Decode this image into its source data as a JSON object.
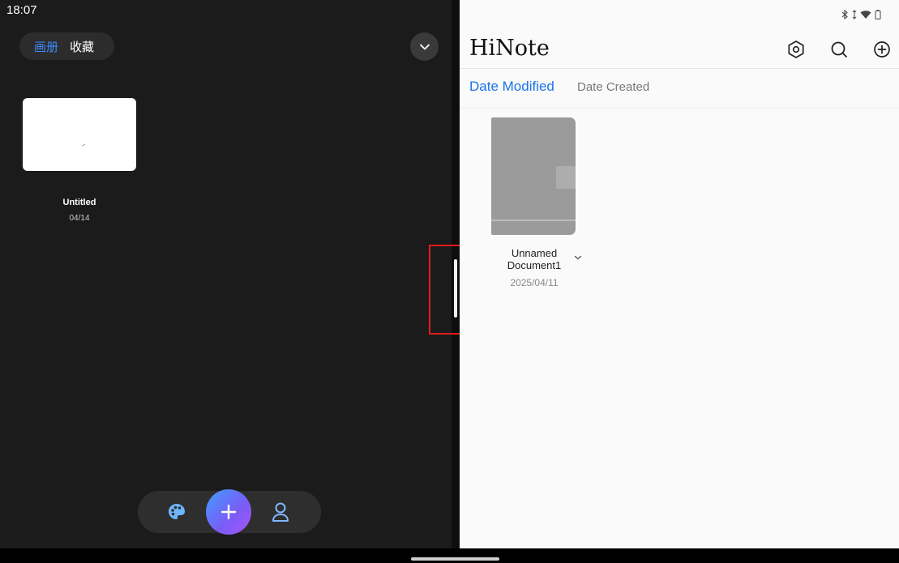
{
  "status_bar": {
    "time": "18:07"
  },
  "drawing_app": {
    "tabs": {
      "album": "画册",
      "favorites": "收藏"
    },
    "artwork": {
      "title": "Untitled",
      "date": "04/14"
    },
    "icons": {
      "expand": "chevron-down-icon",
      "palette": "palette-icon",
      "add": "plus-icon",
      "profile": "user-icon"
    }
  },
  "notes_app": {
    "title": "HiNote",
    "sort": {
      "modified": "Date Modified",
      "created": "Date Created"
    },
    "document": {
      "name": "Unnamed Document1",
      "date": "2025/04/11"
    },
    "icons": {
      "settings": "hexagon-settings-icon",
      "search": "search-icon",
      "new": "add-circle-icon"
    }
  },
  "colors": {
    "accent_blue": "#1a73e8",
    "highlight_red": "#e21b1b",
    "fab_gradient_start": "#3f9cff",
    "fab_gradient_end": "#a855f7"
  }
}
